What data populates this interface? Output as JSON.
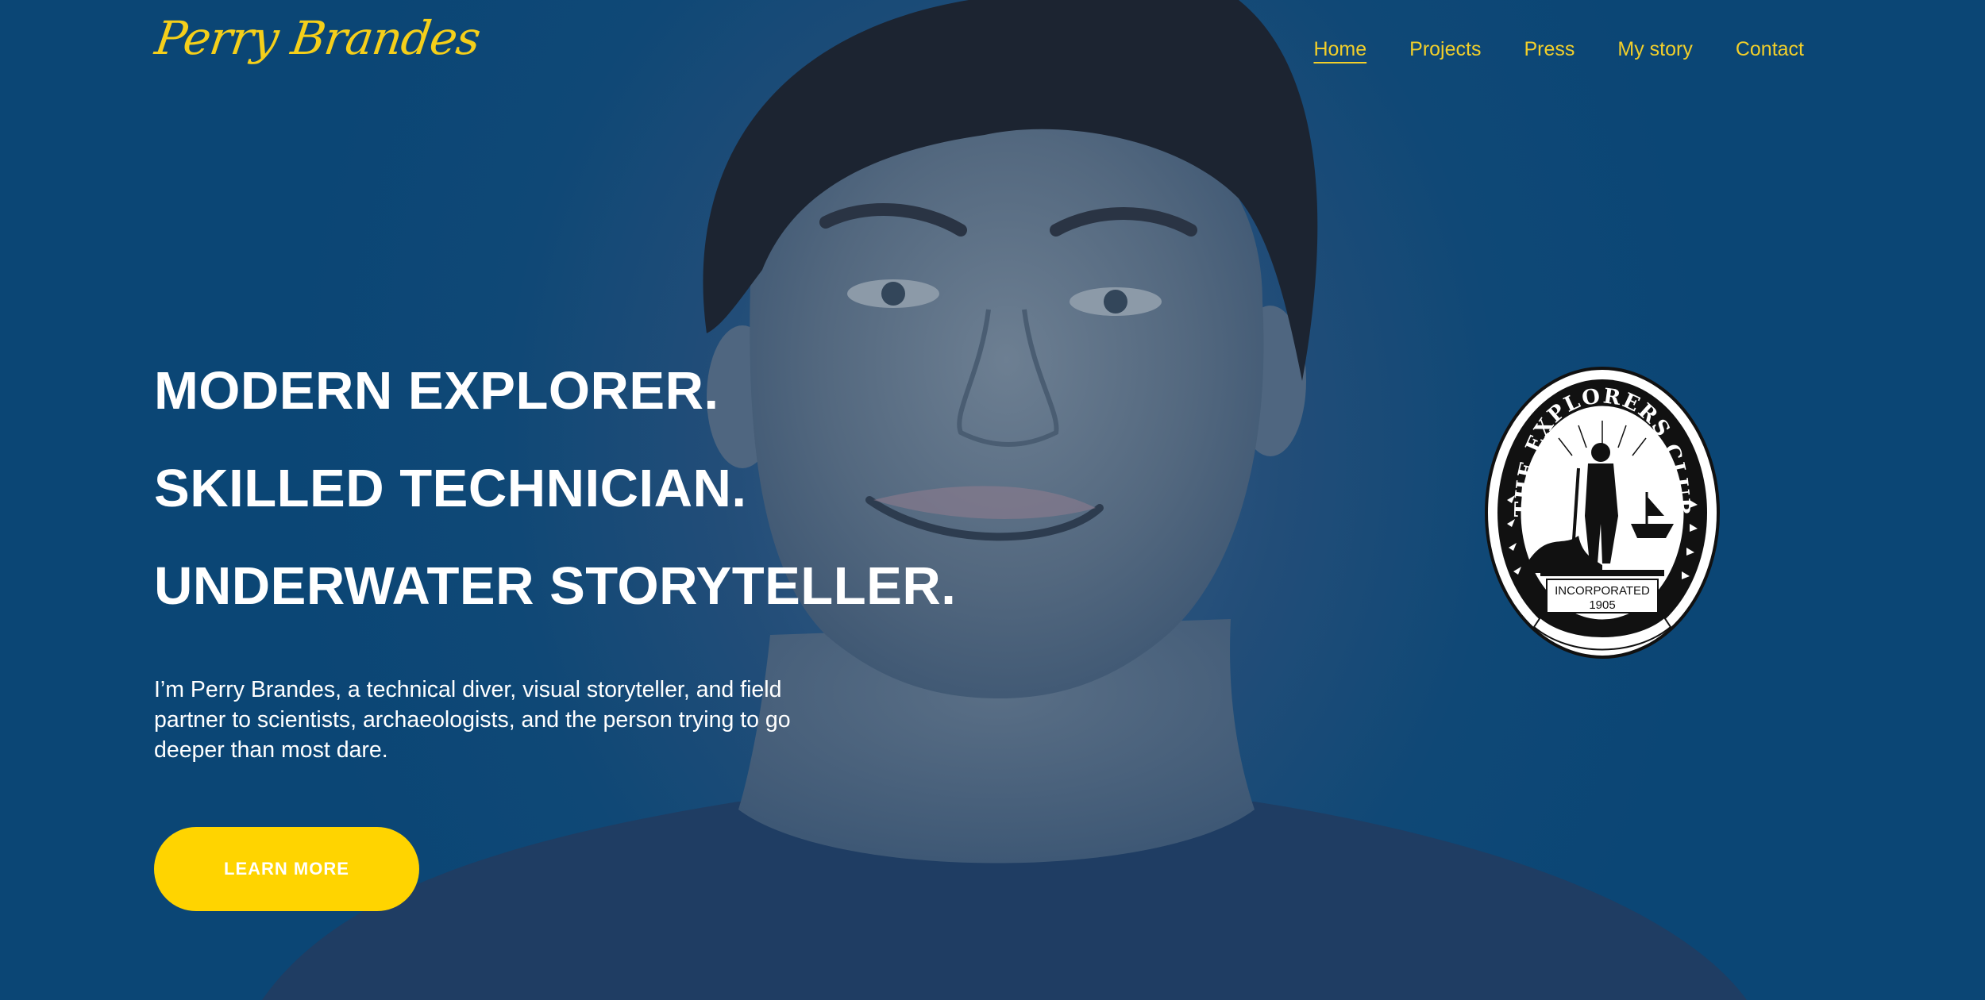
{
  "brand": {
    "logo_text": "Perry Brandes",
    "accent_color": "#ffd400",
    "nav_color": "#f2cf2a",
    "background_color": "#0b4675"
  },
  "nav": {
    "items": [
      {
        "label": "Home",
        "active": true
      },
      {
        "label": "Projects",
        "active": false
      },
      {
        "label": "Press",
        "active": false
      },
      {
        "label": "My story",
        "active": false
      },
      {
        "label": "Contact",
        "active": false
      }
    ]
  },
  "hero": {
    "lines": [
      "MODERN EXPLORER.",
      "SKILLED TECHNICIAN.",
      "UNDERWATER STORYTELLER."
    ],
    "intro": "I’m Perry Brandes, a technical diver, visual storyteller, and field partner to scientists, archaeologists, and the person trying to go deeper than most dare.",
    "cta_label": "LEARN MORE",
    "background_image": "portrait of smiling man in blue-tinted photo"
  },
  "seal": {
    "icon": "explorers-club-seal-icon",
    "ring_text": "THE EXPLORERS CLUB",
    "incorporated_text": "INCORPORATED",
    "year_text": "1905"
  }
}
